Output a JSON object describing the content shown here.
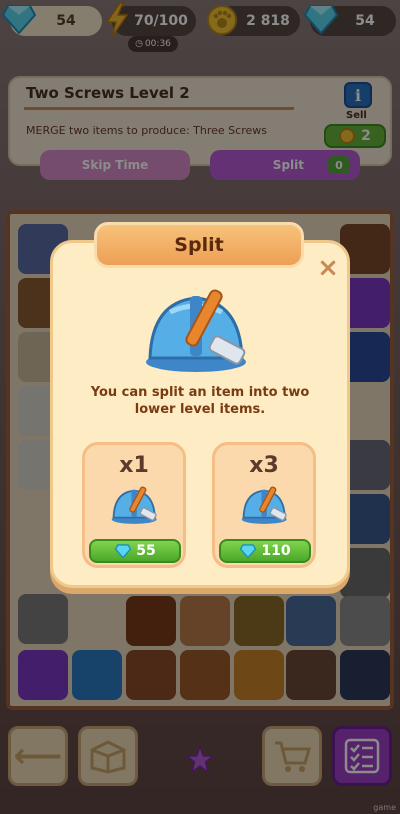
{
  "topbar": {
    "gems_left": "54",
    "energy": "70/100",
    "energy_timer": "00:36",
    "coins": "2 818",
    "gems_right": "54"
  },
  "task": {
    "title": "Two Screws Level 2",
    "description": "MERGE two items to produce:  Three Screws",
    "info_label": "i",
    "sell_label": "Sell",
    "sell_value": "2"
  },
  "actions": {
    "skip_time_label": "Skip Time",
    "split_label": "Split",
    "split_count": "0"
  },
  "modal": {
    "title": "Split",
    "close_label": "×",
    "description": "You can split an item into two lower level items.",
    "options": [
      {
        "multiplier": "x1",
        "price": "55"
      },
      {
        "multiplier": "x3",
        "price": "110"
      }
    ]
  },
  "footer": {
    "watermark": "game"
  },
  "colors": {
    "accent_orange": "#ee9f55",
    "price_green": "#4ca82a",
    "purple_action": "#b85ad6",
    "info_blue": "#2a6fc0"
  }
}
